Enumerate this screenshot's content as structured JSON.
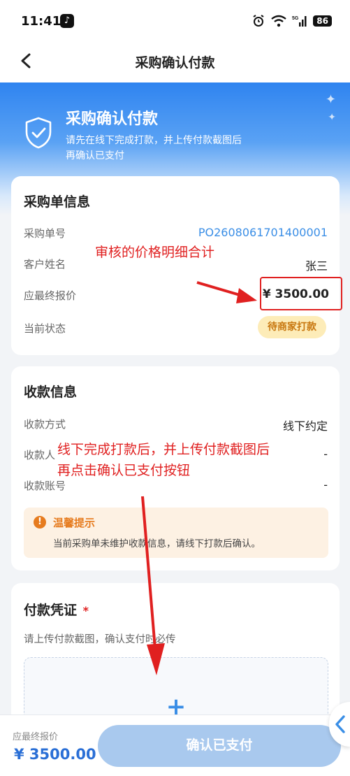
{
  "statusbar": {
    "time": "11:41",
    "network": "5G",
    "battery": "86"
  },
  "nav": {
    "title": "采购确认付款"
  },
  "hero": {
    "title": "采购确认付款",
    "desc_line1": "请先在线下完成打款，并上传付款截图后",
    "desc_line2": "再确认已支付"
  },
  "order_card": {
    "title": "采购单信息",
    "rows": [
      {
        "label": "采购单号",
        "value": "PO2608061701400001"
      },
      {
        "label": "客户姓名",
        "value": "张三"
      },
      {
        "label": "应最终报价",
        "value": "¥ 3500.00"
      },
      {
        "label": "当前状态",
        "value": "待商家打款"
      }
    ]
  },
  "payee_card": {
    "title": "收款信息",
    "rows": [
      {
        "label": "收款方式",
        "value": "线下约定"
      },
      {
        "label": "收款人",
        "value": "-"
      },
      {
        "label": "收款账号",
        "value": "-"
      }
    ],
    "tip": {
      "title": "温馨提示",
      "text": "当前采购单未维护收款信息，请线下打款后确认。"
    }
  },
  "voucher_card": {
    "title": "付款凭证",
    "required_mark": "*",
    "desc": "请上传付款截图，确认支付时必传",
    "upload_plus": "+"
  },
  "annotations": {
    "price_note": "审核的价格明细合计",
    "upload_note_line1": "线下完成打款后，并上传付款截图后",
    "upload_note_line2": "再点击确认已支付按钮"
  },
  "bottom": {
    "price_label": "应最终报价",
    "price_value": "¥ 3500.00",
    "confirm_button": "确认已支付"
  },
  "colors": {
    "accent": "#3a8ee6",
    "annotation_red": "#e02020",
    "badge_bg": "#fdecb8",
    "badge_text": "#c8770f",
    "button_disabled": "#a9c9ee"
  }
}
